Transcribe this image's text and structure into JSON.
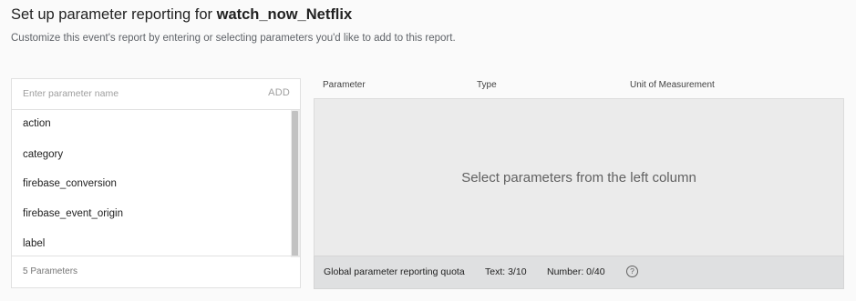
{
  "header": {
    "title_prefix": "Set up parameter reporting for ",
    "event_name": "watch_now_Netflix",
    "subtitle": "Customize this event's report by entering or selecting parameters you'd like to add to this report."
  },
  "left_panel": {
    "search_placeholder": "Enter parameter name",
    "add_label": "ADD",
    "items": [
      {
        "label": "action"
      },
      {
        "label": "category"
      },
      {
        "label": "firebase_conversion"
      },
      {
        "label": "firebase_event_origin"
      },
      {
        "label": "label"
      }
    ],
    "count_label": "5 Parameters"
  },
  "right_panel": {
    "columns": {
      "parameter": "Parameter",
      "type": "Type",
      "unit": "Unit of Measurement"
    },
    "empty_message": "Select parameters from the left column",
    "quota": {
      "label": "Global parameter reporting quota",
      "text": "Text: 3/10",
      "number": "Number: 0/40",
      "help_icon": "?"
    }
  }
}
